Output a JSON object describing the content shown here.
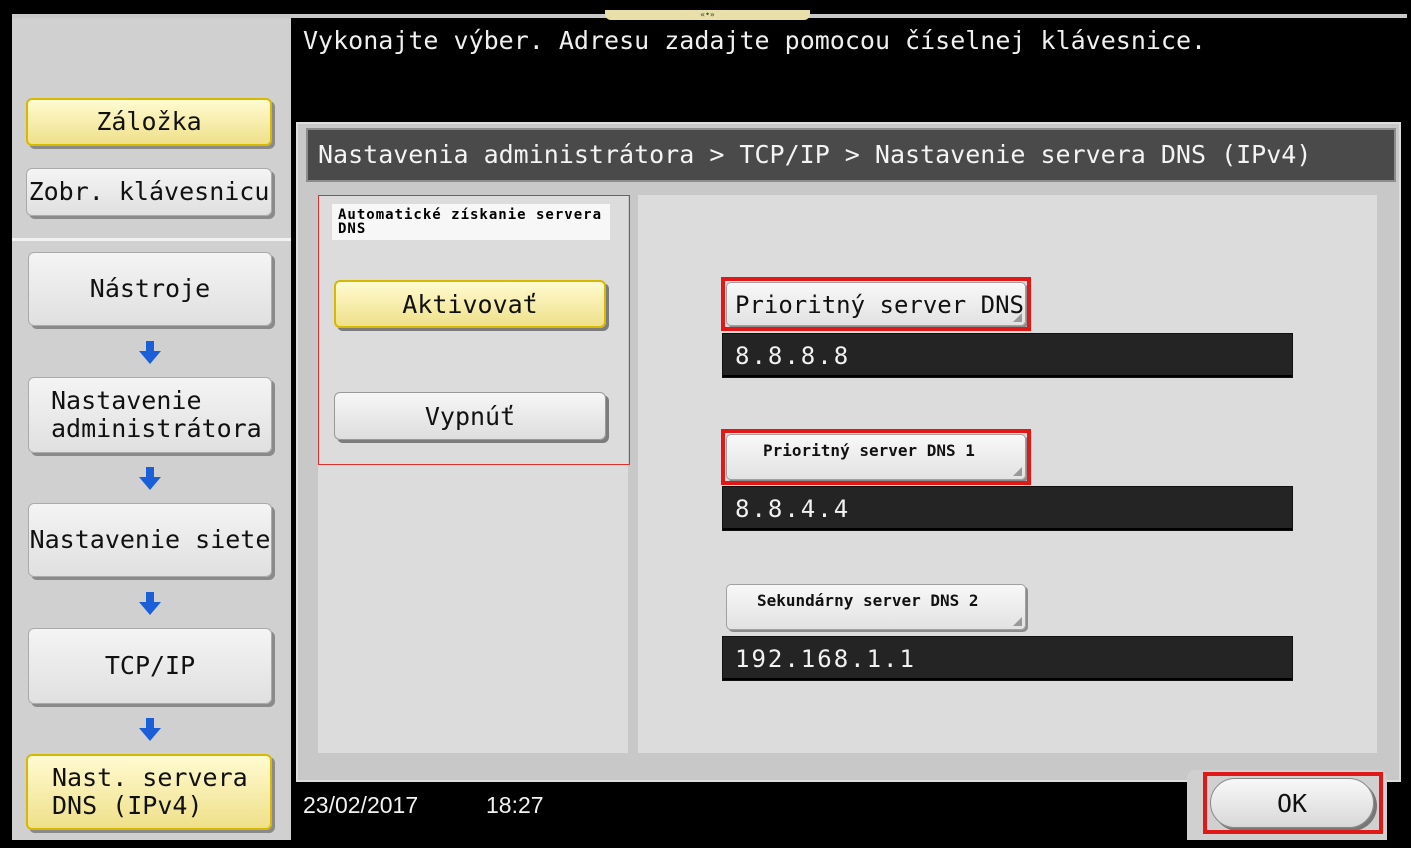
{
  "message": "Vykonajte výber. Adresu zadajte pomocou číselnej klávesnice.",
  "breadcrumb": "Nastavenia administrátora > TCP/IP > Nastavenie servera DNS (IPv4)",
  "sidebar": {
    "bookmark": "Záložka",
    "keyboard": "Zobr. klávesnicu",
    "path": [
      {
        "label": "Nástroje"
      },
      {
        "label": "Nastavenie administrátora"
      },
      {
        "label": "Nastavenie siete"
      },
      {
        "label": "TCP/IP"
      },
      {
        "label": "Nast. servera DNS (IPv4)"
      }
    ]
  },
  "auto_dns": {
    "label": "Automatické získanie servera DNS",
    "enable": "Aktivovať",
    "disable": "Vypnúť",
    "selected": "Aktivovať"
  },
  "dns": {
    "primary": {
      "label": "Prioritný server DNS",
      "value": "8.8.8.8"
    },
    "primary1": {
      "label": "Prioritný server DNS 1",
      "value": "8.8.4.4"
    },
    "secondary2": {
      "label": "Sekundárny server DNS 2",
      "value": "192.168.1.1"
    }
  },
  "status": {
    "date": "23/02/2017",
    "time": "18:27"
  },
  "ok_label": "OK",
  "colors": {
    "highlight": "#e01818",
    "selected": "#efe08a",
    "arrow": "#1a5fd8"
  }
}
